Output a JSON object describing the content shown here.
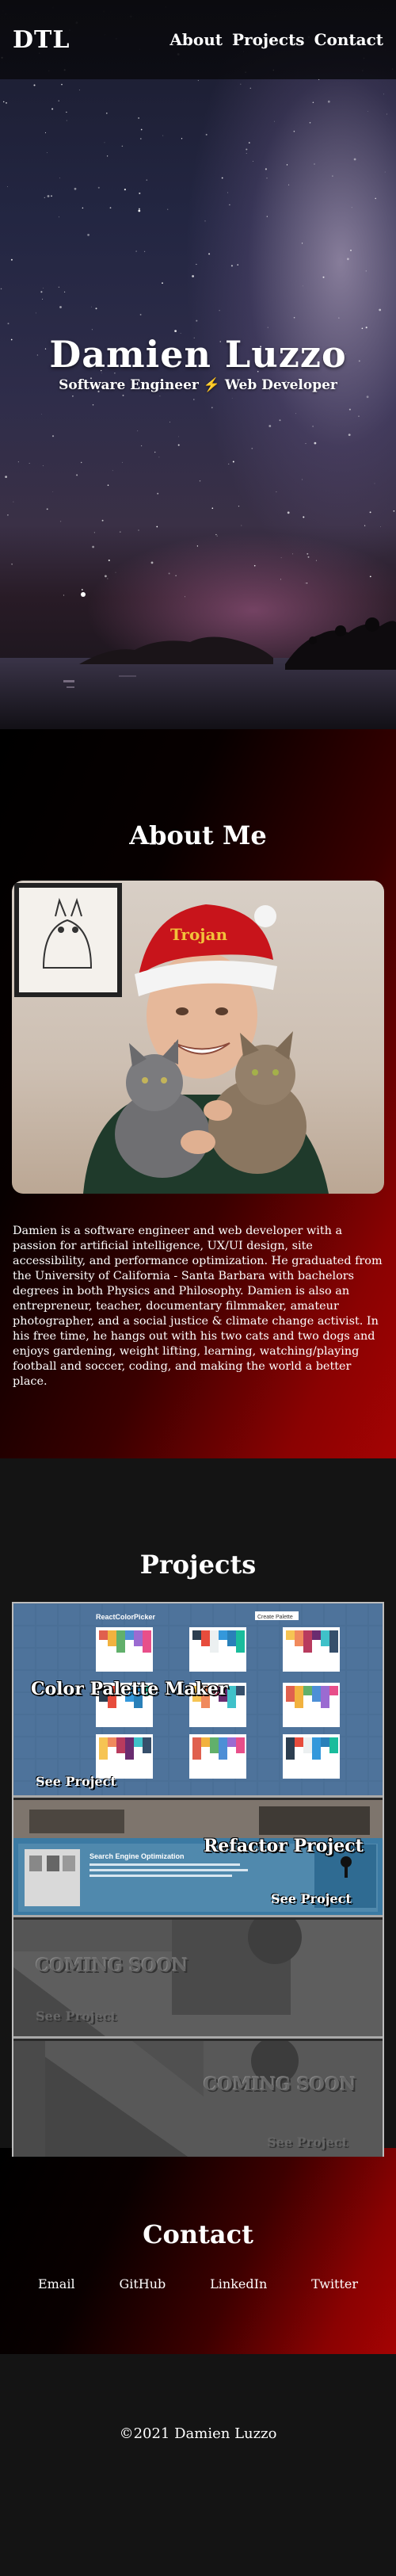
{
  "nav": {
    "logo": "DTL",
    "links": [
      {
        "label": "About"
      },
      {
        "label": "Projects"
      },
      {
        "label": "Contact"
      }
    ]
  },
  "hero": {
    "name": "Damien Luzzo",
    "subtitle": "Software Engineer ⚡ Web Developer"
  },
  "about": {
    "title": "About Me",
    "bio": "Damien is a software engineer and web developer with a passion for artificial intelligence, UX/UI design, site accessibility, and performance optimization. He graduated from the University of California - Santa Barbara with bachelors degrees in both Physics and Philosophy. Damien is also an entrepreneur, teacher, documentary filmmaker, amateur photographer, and a social justice & climate change activist. In his free time, he hangs out with his two cats and two dogs and enjoys gardening, weight lifting, learning, watching/playing football and soccer, coding, and making the world a better place.",
    "photo_hat_text": "Trojan"
  },
  "projects": {
    "title": "Projects",
    "items": [
      {
        "title": "Color Palette Maker",
        "link_label": "See Project",
        "preview_heading": "ReactColorPicker",
        "preview_button": "Create Palette"
      },
      {
        "title": "Refactor Project",
        "link_label": "See Project",
        "preview_heading": "Search Engine Optimization"
      },
      {
        "title": "COMING SOON",
        "link_label": "See Project"
      },
      {
        "title": "COMING SOON",
        "link_label": "See Project"
      }
    ],
    "palette_colors": [
      [
        "#e0604e",
        "#f2b23f",
        "#61b06b",
        "#4d8fd6",
        "#9b6bd1",
        "#e84f8a"
      ],
      [
        "#2c3e50",
        "#e74c3c",
        "#ecf0f1",
        "#3498db",
        "#2980b9",
        "#1abc9c"
      ],
      [
        "#f6c453",
        "#f08a5d",
        "#b83b5e",
        "#6a2c70",
        "#3fc1c9",
        "#364f6b"
      ]
    ]
  },
  "contact": {
    "title": "Contact",
    "links": [
      {
        "label": "Email"
      },
      {
        "label": "GitHub"
      },
      {
        "label": "LinkedIn"
      },
      {
        "label": "Twitter"
      }
    ]
  },
  "footer": {
    "copyright": "©2021 Damien Luzzo"
  },
  "colors": {
    "accent_red": "#a50303",
    "background": "#141414",
    "project_blue": "#4a6f96"
  }
}
